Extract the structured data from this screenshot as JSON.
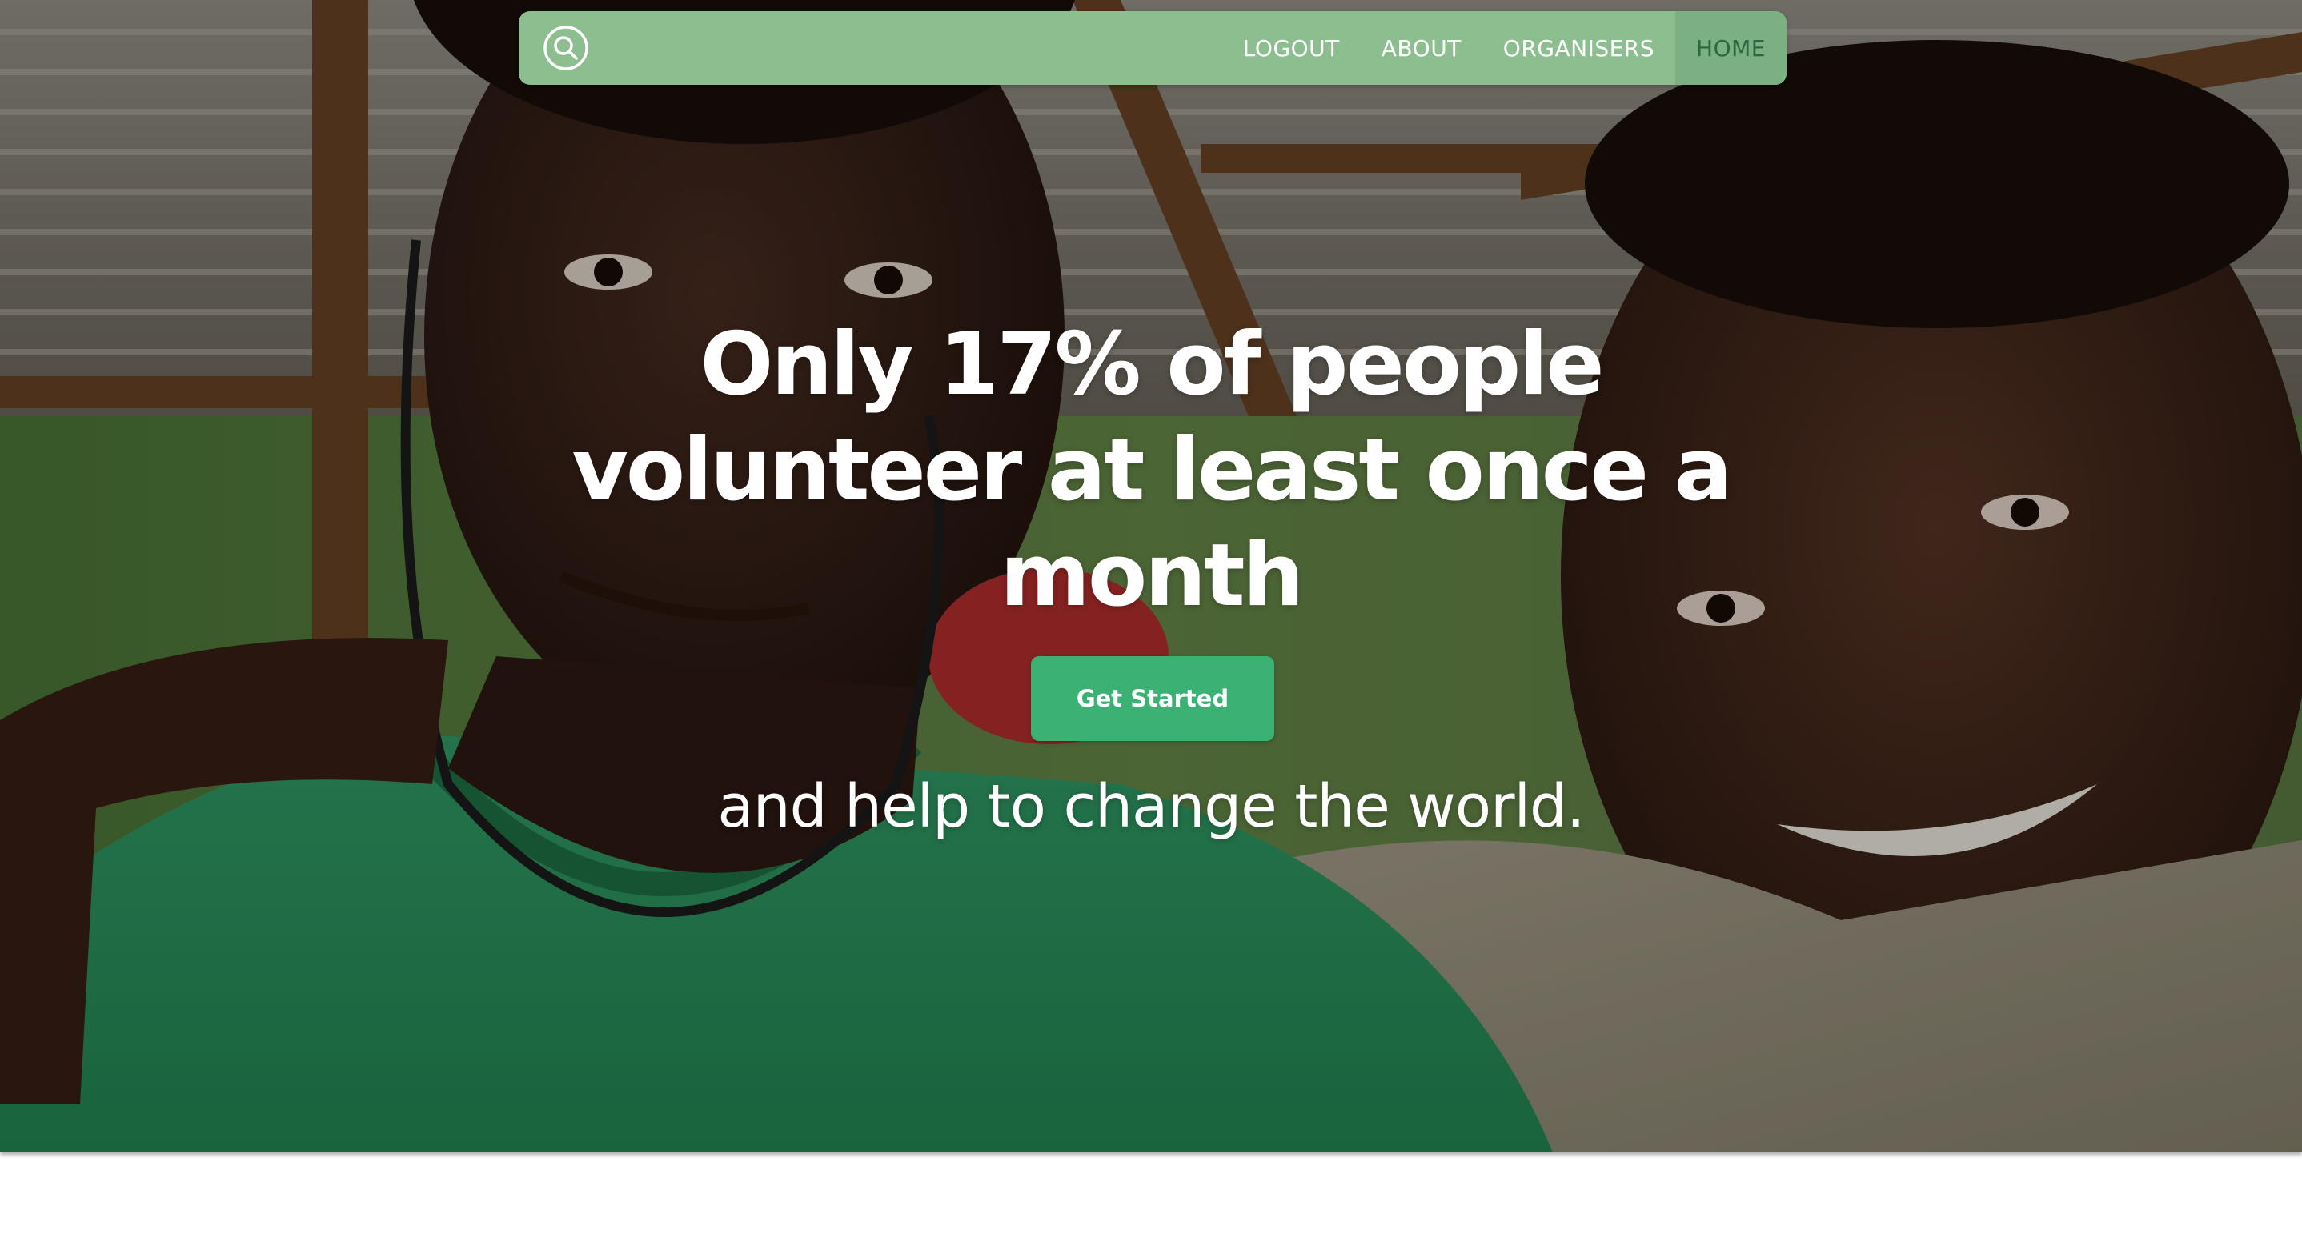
{
  "navbar": {
    "search_icon": "search-icon",
    "links": [
      {
        "label": "LOGOUT",
        "active": false
      },
      {
        "label": "ABOUT",
        "active": false
      },
      {
        "label": "ORGANISERS",
        "active": false
      },
      {
        "label": "HOME",
        "active": true
      }
    ]
  },
  "hero": {
    "headline": "Only 17% of people volunteer at least once a month",
    "cta_label": "Get Started",
    "tagline": "and help to change the world."
  },
  "colors": {
    "navbar_bg": "#8dbe90",
    "nav_active_bg": "#7bb082",
    "nav_active_text": "#2b6840",
    "cta_bg": "#3bb273",
    "text": "#ffffff"
  }
}
